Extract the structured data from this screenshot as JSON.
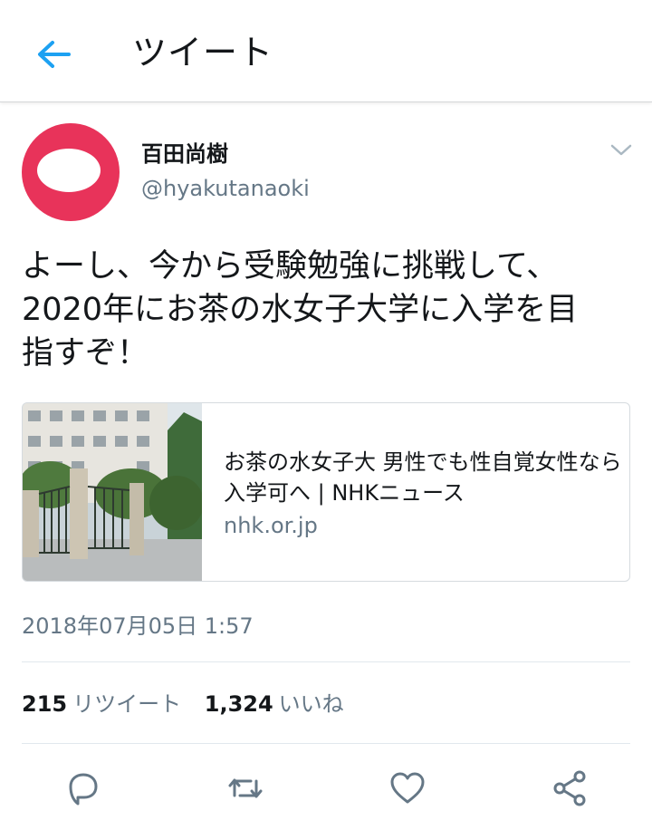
{
  "header": {
    "title": "ツイート",
    "back_icon": "back-arrow-icon",
    "accent": "#1da1f2"
  },
  "tweet": {
    "display_name": "百田尚樹",
    "handle": "@hyakutanaoki",
    "avatar": {
      "ring_color": "#e8335a",
      "inner_color": "#ffffff"
    },
    "menu_icon": "chevron-down-icon",
    "text": "よーし、今から受験勉強に挑戦して、\n2020年にお茶の水女子大学に入学を目\n指すぞ！",
    "card": {
      "title": "お茶の水女子大 男性でも性自覚女性なら入学可へ | NHKニュース",
      "domain": "nhk.or.jp",
      "image_icon": "campus-gate-photo"
    },
    "timestamp": "2018年07月05日 1:57",
    "stats": {
      "retweets": {
        "count": "215",
        "label": "リツイート"
      },
      "likes": {
        "count": "1,324",
        "label": "いいね"
      }
    }
  },
  "actions": [
    {
      "name": "reply",
      "icon": "reply-icon"
    },
    {
      "name": "retweet",
      "icon": "retweet-icon"
    },
    {
      "name": "like",
      "icon": "heart-icon"
    },
    {
      "name": "share",
      "icon": "share-icon"
    }
  ],
  "colors": {
    "text": "#14171a",
    "secondary": "#657786",
    "border": "#e1e8ed"
  }
}
